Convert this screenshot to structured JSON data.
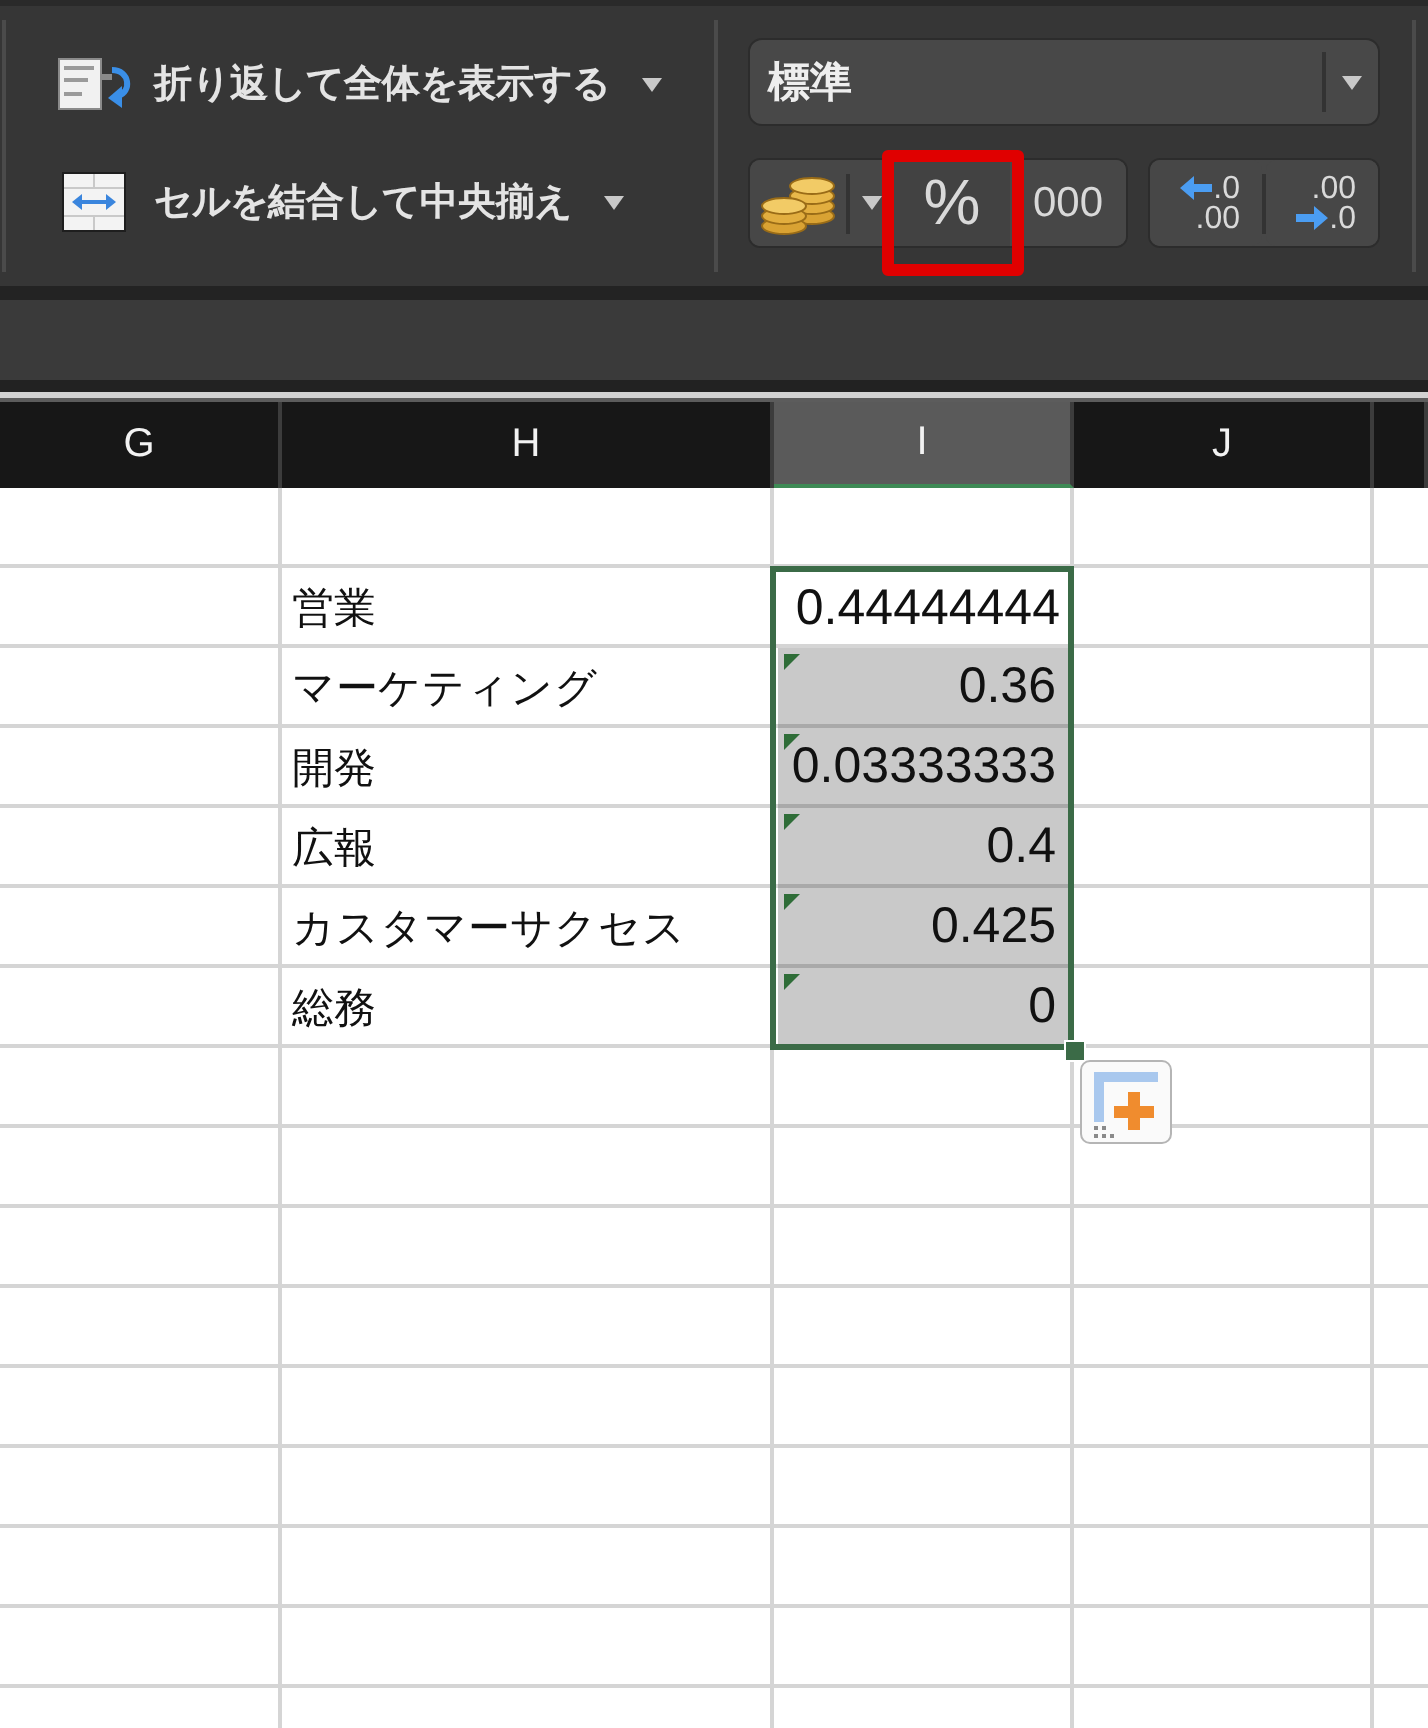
{
  "ribbon": {
    "alignment_buttons": [
      {
        "kind": "wrap_text",
        "label": "折り返して全体を表示する",
        "dropdown": true
      },
      {
        "kind": "merge_center",
        "label": "セルを結合して中央揃え",
        "dropdown": true
      }
    ],
    "number_format": {
      "value": "標準"
    },
    "number_buttons": [
      {
        "kind": "currency",
        "dropdown": true,
        "highlighted": false
      },
      {
        "kind": "percent",
        "label": "%",
        "highlighted": true
      },
      {
        "kind": "comma",
        "label": "000",
        "highlighted": false
      }
    ],
    "decimal_buttons": [
      {
        "kind": "decrease",
        "top": ".0",
        "bottom": ".00"
      },
      {
        "kind": "increase",
        "top": ".00",
        "bottom": ".0"
      }
    ]
  },
  "sheet": {
    "columns": [
      {
        "label": "G",
        "selected": false
      },
      {
        "label": "H",
        "selected": false
      },
      {
        "label": "I",
        "selected": true
      },
      {
        "label": "J",
        "selected": false
      },
      {
        "selected": false
      }
    ],
    "rows": [
      {
        "label": "営業",
        "value": "0.44444444",
        "selected": true,
        "active": true,
        "flagged": false
      },
      {
        "label": "マーケティング",
        "value": "0.36",
        "selected": true,
        "active": false,
        "flagged": true
      },
      {
        "label": "開発",
        "value": "0.03333333",
        "selected": true,
        "active": false,
        "flagged": true
      },
      {
        "label": "広報",
        "value": "0.4",
        "selected": true,
        "active": false,
        "flagged": true
      },
      {
        "label": "カスタマーサクセス",
        "value": "0.425",
        "selected": true,
        "active": false,
        "flagged": true
      },
      {
        "label": "総務",
        "value": "0",
        "selected": true,
        "active": false,
        "flagged": true
      }
    ]
  }
}
